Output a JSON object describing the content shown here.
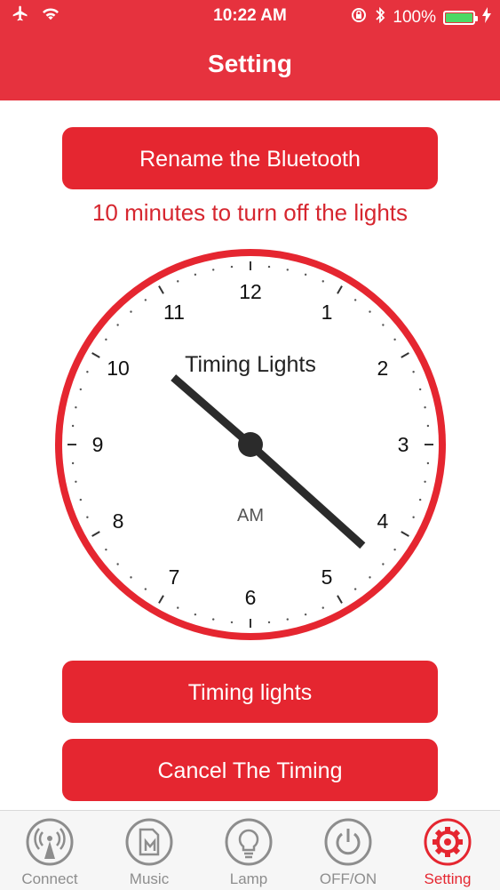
{
  "status_bar": {
    "time": "10:22 AM",
    "battery": "100%"
  },
  "nav": {
    "title": "Setting"
  },
  "buttons": {
    "rename": "Rename the Bluetooth",
    "timing": "Timing lights",
    "cancel": "Cancel The Timing"
  },
  "info_text": "10 minutes to turn off the lights",
  "clock": {
    "title": "Timing Lights",
    "period": "AM",
    "numbers": [
      "12",
      "1",
      "2",
      "3",
      "4",
      "5",
      "6",
      "7",
      "8",
      "9",
      "10",
      "11"
    ],
    "hand_time": "10:22"
  },
  "tabs": [
    {
      "label": "Connect",
      "icon": "antenna-icon"
    },
    {
      "label": "Music",
      "icon": "music-file-icon"
    },
    {
      "label": "Lamp",
      "icon": "lightbulb-icon"
    },
    {
      "label": "OFF/ON",
      "icon": "power-icon"
    },
    {
      "label": "Setting",
      "icon": "gear-icon",
      "active": true
    }
  ],
  "colors": {
    "accent": "#e52630",
    "header": "#e6323e",
    "inactive": "#8d8d8d",
    "battery": "#4cd964"
  }
}
